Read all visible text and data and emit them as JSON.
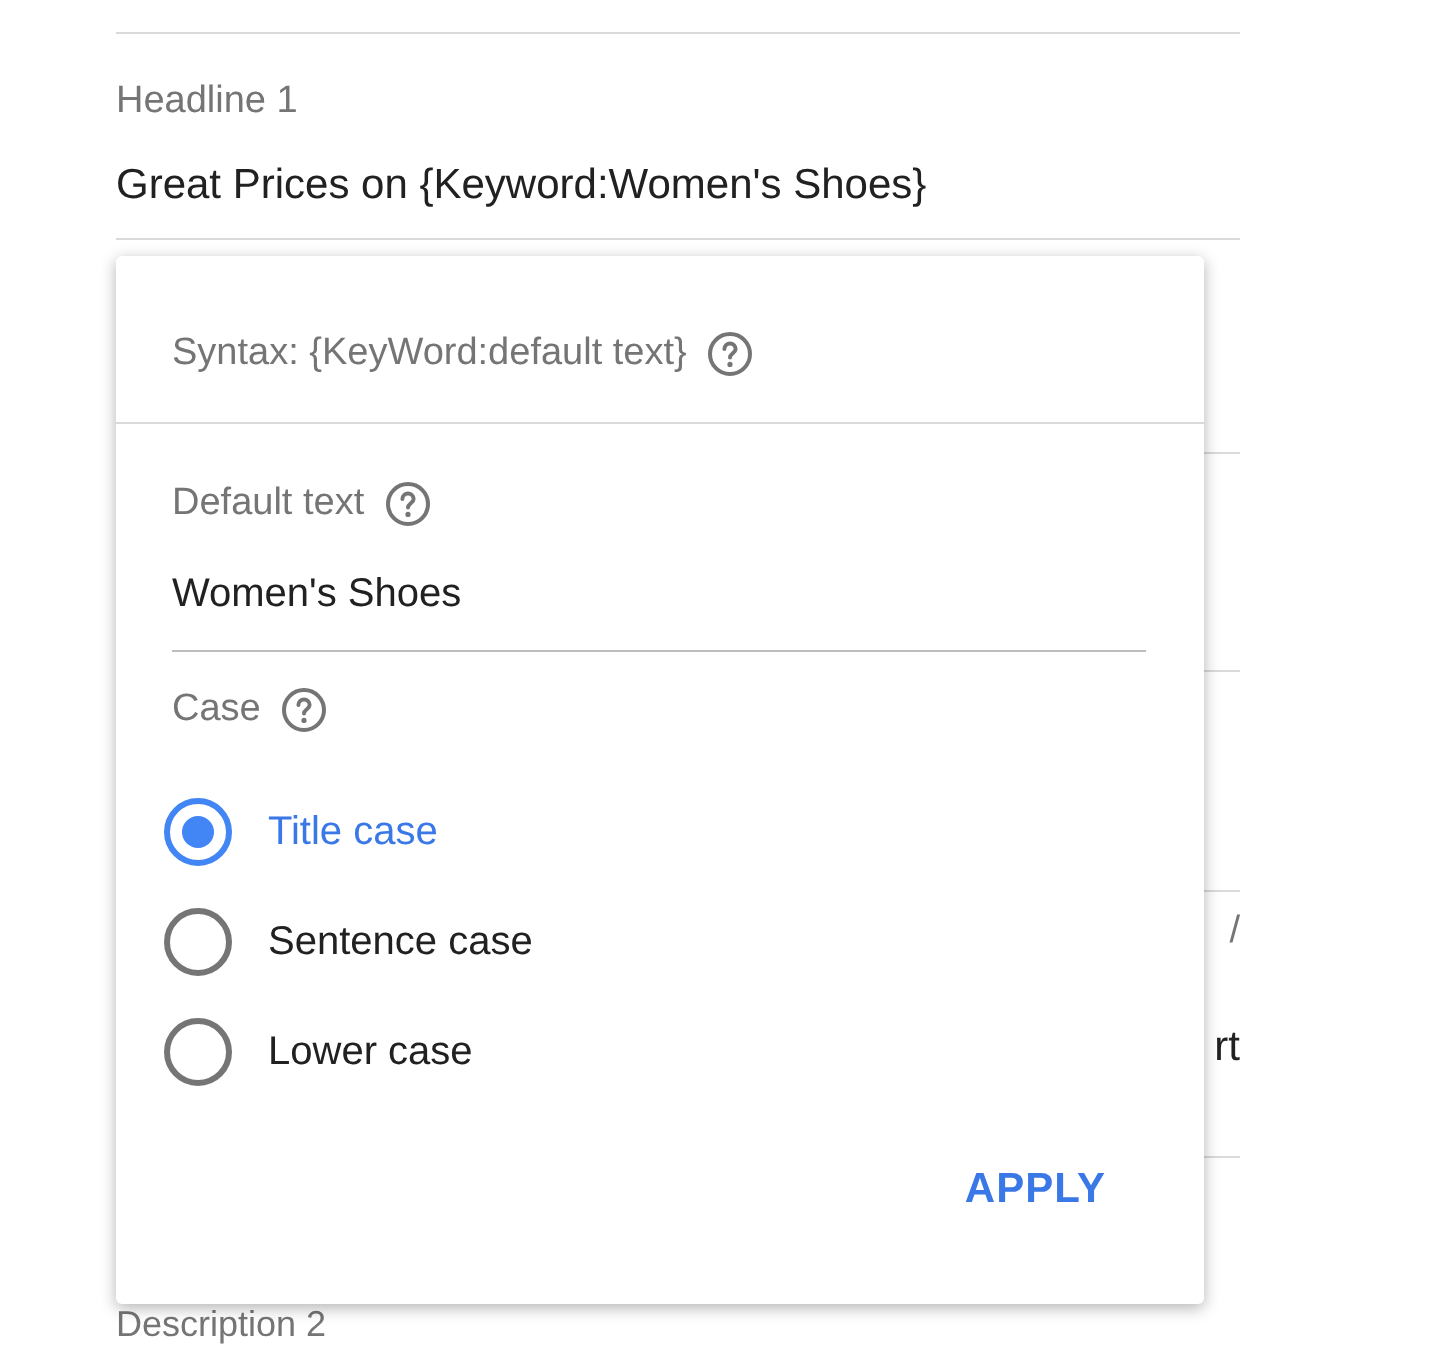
{
  "form": {
    "headline": {
      "label": "Headline 1",
      "value": "Great Prices on {Keyword:Women's Shoes}"
    },
    "counter_fragment": "/",
    "value_fragment": "rt",
    "bottom_label": "Description 2"
  },
  "popup": {
    "syntax": "Syntax: {KeyWord:default text}",
    "default_text": {
      "label": "Default text",
      "value": "Women's Shoes"
    },
    "case": {
      "label": "Case",
      "options": [
        {
          "label": "Title case",
          "selected": true
        },
        {
          "label": "Sentence case",
          "selected": false
        },
        {
          "label": "Lower case",
          "selected": false
        }
      ]
    },
    "apply": "APPLY"
  }
}
